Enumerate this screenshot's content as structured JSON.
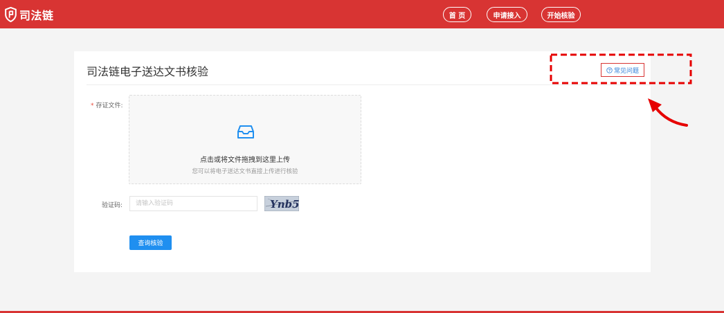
{
  "header": {
    "logo_text": "司法链",
    "nav": [
      {
        "label": "首 页"
      },
      {
        "label": "申请接入"
      },
      {
        "label": "开始核验"
      }
    ]
  },
  "card": {
    "title": "司法链电子送达文书核验",
    "faq_label": "常见问题"
  },
  "form": {
    "file_label": "存证文件:",
    "required_mark": "*",
    "upload_title": "点击或将文件拖拽到这里上传",
    "upload_hint": "您可以将电子送达文书直接上传进行核验",
    "captcha_label": "验证码:",
    "captcha_placeholder": "请输入验证码",
    "captcha_value": "",
    "captcha_image_text": "Ynb5",
    "submit_label": "查询核验"
  },
  "colors": {
    "brand_red": "#d83433",
    "primary_blue": "#1f8ff0",
    "link_blue": "#2f7fd8",
    "annotation_red": "#e60000"
  },
  "icons": [
    "logo-shield-icon",
    "question-circle-icon",
    "inbox-icon",
    "annotation-arrow-icon"
  ]
}
